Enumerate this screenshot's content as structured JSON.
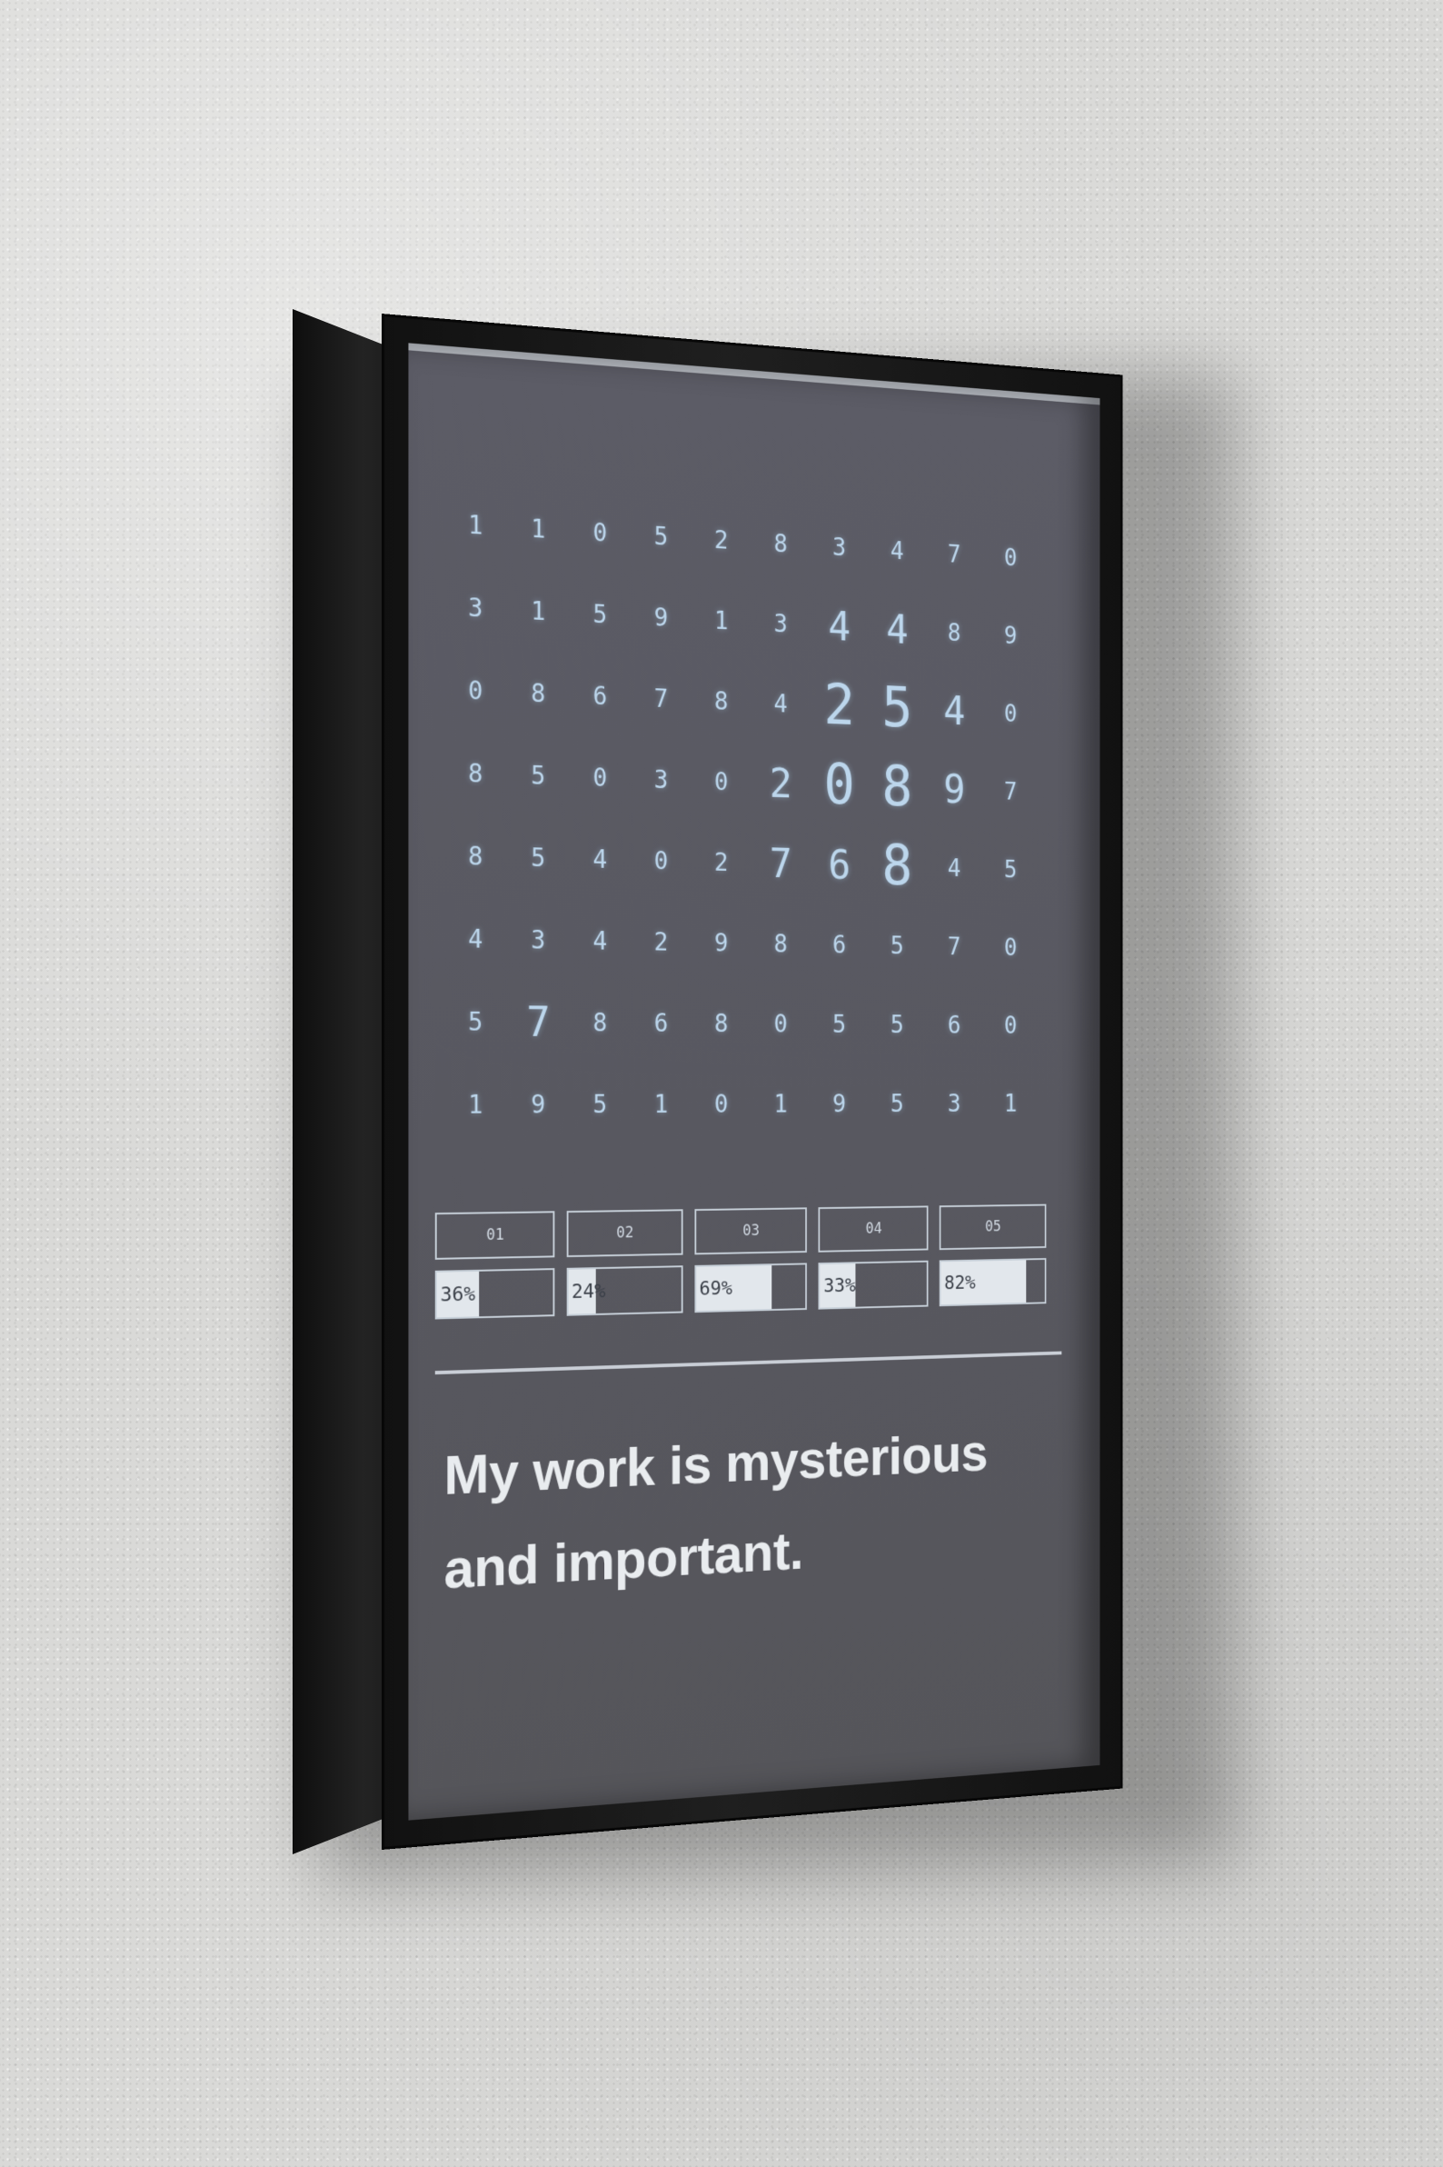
{
  "grid": [
    [
      "1",
      "1",
      "0",
      "5",
      "2",
      "8",
      "3",
      "4",
      "7",
      "0"
    ],
    [
      "3",
      "1",
      "5",
      "9",
      "1",
      "3",
      "4",
      "4",
      "8",
      "9"
    ],
    [
      "0",
      "8",
      "6",
      "7",
      "8",
      "4",
      "2",
      "5",
      "4",
      "0"
    ],
    [
      "8",
      "5",
      "0",
      "3",
      "0",
      "2",
      "0",
      "8",
      "9",
      "7"
    ],
    [
      "8",
      "5",
      "4",
      "0",
      "2",
      "7",
      "6",
      "8",
      "4",
      "5"
    ],
    [
      "4",
      "3",
      "4",
      "2",
      "9",
      "8",
      "6",
      "5",
      "7",
      "0"
    ],
    [
      "5",
      "7",
      "8",
      "6",
      "8",
      "0",
      "5",
      "5",
      "6",
      "0"
    ],
    [
      "1",
      "9",
      "5",
      "1",
      "0",
      "1",
      "9",
      "5",
      "3",
      "1"
    ]
  ],
  "bins": [
    {
      "label": "01",
      "percent_text": "36%",
      "fill": 0.36
    },
    {
      "label": "02",
      "percent_text": "24%",
      "fill": 0.24
    },
    {
      "label": "03",
      "percent_text": "69%",
      "fill": 0.69
    },
    {
      "label": "04",
      "percent_text": "33%",
      "fill": 0.33
    },
    {
      "label": "05",
      "percent_text": "82%",
      "fill": 0.82
    }
  ],
  "tagline": "My work is mysterious and important.",
  "colors": {
    "wall": "#d9d9d7",
    "frame": "#151515",
    "poster": "#5a5a63",
    "digits": "#bcd6ec",
    "text": "#e9ecef"
  }
}
